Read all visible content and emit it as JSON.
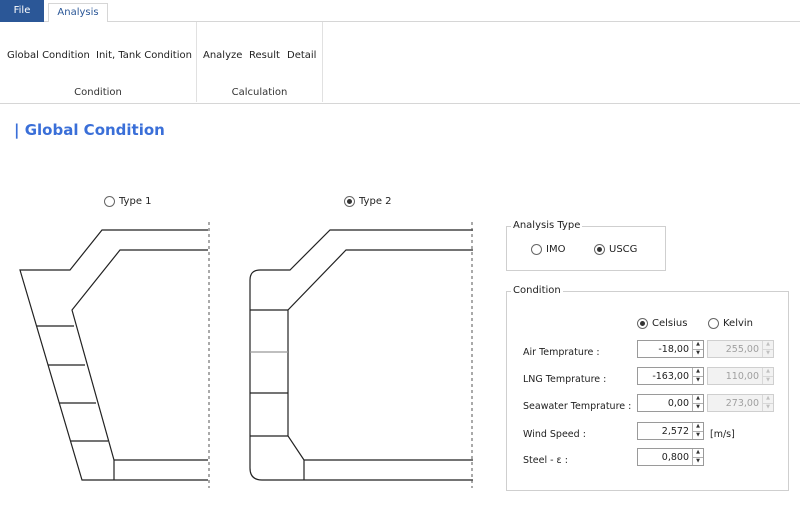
{
  "tabs": {
    "file": "File",
    "analysis": "Analysis"
  },
  "ribbon": {
    "condition": {
      "global": "Global Condition",
      "init_tank": "Init, Tank Condition",
      "label": "Condition"
    },
    "calculation": {
      "analyze": "Analyze",
      "result": "Result",
      "detail": "Detail",
      "label": "Calculation"
    }
  },
  "page_title": "| Global Condition",
  "types": [
    {
      "label": "Type 1",
      "selected": false
    },
    {
      "label": "Type 2",
      "selected": true
    }
  ],
  "analysis_type": {
    "title": "Analysis Type",
    "options": [
      {
        "label": "IMO",
        "selected": false
      },
      {
        "label": "USCG",
        "selected": true
      }
    ]
  },
  "condition": {
    "title": "Condition",
    "units": [
      {
        "label": "Celsius",
        "selected": true
      },
      {
        "label": "Kelvin",
        "selected": false
      }
    ],
    "fields": [
      {
        "label": "Air Temprature :",
        "value": "-18,00",
        "kelvin": "255,00"
      },
      {
        "label": "LNG Temprature :",
        "value": "-163,00",
        "kelvin": "110,00"
      },
      {
        "label": "Seawater Temprature :",
        "value": "0,00",
        "kelvin": "273,00"
      },
      {
        "label": "Wind Speed :",
        "value": "2,572",
        "unit": "[m/s]"
      },
      {
        "label": "Steel - ε :",
        "value": "0,800"
      }
    ]
  }
}
